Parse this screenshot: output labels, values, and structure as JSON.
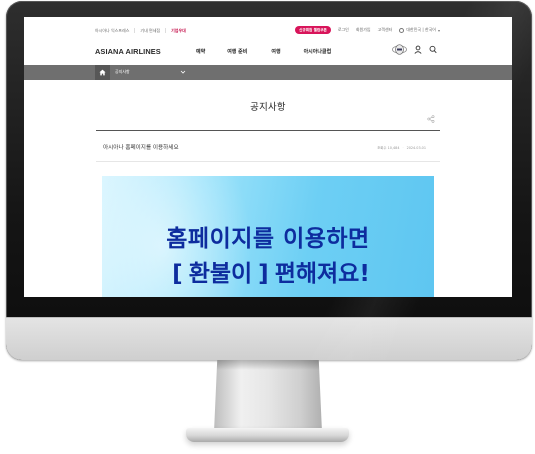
{
  "utility": {
    "links": [
      "아시아나 익스프레스",
      "기내 면세점",
      "기업우대"
    ],
    "promo": "신규회원 웰컴쿠폰",
    "login": "로그인",
    "signup": "회원가입",
    "support": "고객센터",
    "language": "대한민국 | 한국어"
  },
  "header": {
    "logo": "ASIANA AIRLINES",
    "menu": [
      "예약",
      "여행 준비",
      "여행",
      "아시아나클럽"
    ],
    "icons": [
      "club-badge-icon",
      "user-icon",
      "search-icon"
    ]
  },
  "breadcrumb": {
    "home_icon": "home-icon",
    "label": "공지사항"
  },
  "page": {
    "title": "공지사항",
    "notice_title": "아시아나 홈페이지를 이용하세요",
    "views": "조회수 10,484",
    "date": "2024.03.01"
  },
  "banner": {
    "line1": "홈페이지를 이용하면",
    "bracket_open": "[",
    "highlight": "환불이",
    "bracket_close": "]",
    "line2_rest": "편해져요!"
  },
  "colors": {
    "brand_red": "#c6164f",
    "promo_pink": "#d8145a",
    "breadcrumb_gray": "#6f6f6f",
    "banner_text": "#0d2c9e"
  }
}
